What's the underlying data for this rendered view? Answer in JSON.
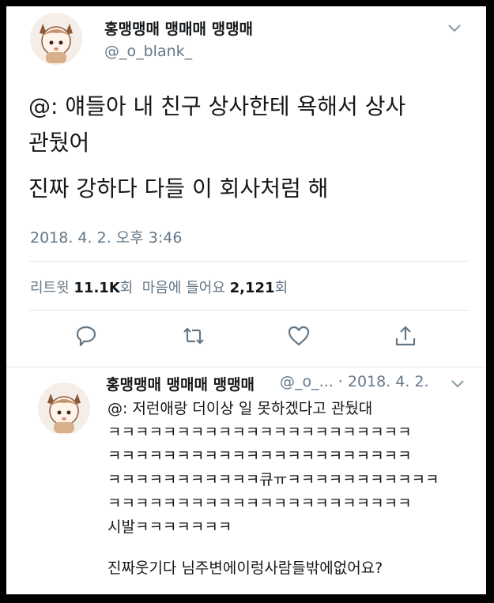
{
  "tweet": {
    "display_name": "홍맹맹매 맹매매 맹맹매",
    "handle": "@_o_blank_",
    "text_line1": "@: 얘들아 내 친구 상사한테 욕해서 상사",
    "text_line2": "관뒀어",
    "text_line3": "진짜 강하다 다들 이 회사처럼 해",
    "timestamp": "2018. 4. 2. 오후 3:46",
    "retweet_label": "리트윗",
    "retweet_count": "11.1K",
    "retweet_unit": "회",
    "like_label": "마음에 들어요",
    "like_count": "2,121",
    "like_unit": "회"
  },
  "reply": {
    "display_name": "홍맹맹매 맹매매 맹맹매",
    "handle_date": "@_o_... · 2018. 4. 2.",
    "line1": "@: 저런애랑 더이상 일 못하겠다고 관뒀대",
    "line2": "ㅋㅋㅋㅋㅋㅋㅋㅋㅋㅋㅋㅋㅋㅋㅋㅋㅋㅋㅋㅋㅋㅋ",
    "line3": "ㅋㅋㅋㅋㅋㅋㅋㅋㅋㅋㅋㅋㅋㅋㅋㅋㅋㅋㅋㅋㅋㅋ",
    "line4": "ㅋㅋㅋㅋㅋㅋㅋㅋㅋㅋㅋ큐ㅠㅋㅋㅋㅋㅋㅋㅋㅋㅋㅋㅋ",
    "line5": "ㅋㅋㅋㅋㅋㅋㅋㅋㅋㅋㅋㅋㅋㅋㅋㅋㅋㅋㅋㅋㅋㅋ",
    "line6": "시발ㅋㅋㅋㅋㅋㅋㅋ",
    "line7": "진짜웃기다 님주변에이렁사람들밖에없어요?"
  },
  "colors": {
    "text": "#14171a",
    "secondary": "#657786",
    "divider": "#e1e8ed",
    "frame": "#000000"
  },
  "icons": [
    "reply-icon",
    "retweet-icon",
    "like-icon",
    "share-icon",
    "chevron-down-icon"
  ]
}
